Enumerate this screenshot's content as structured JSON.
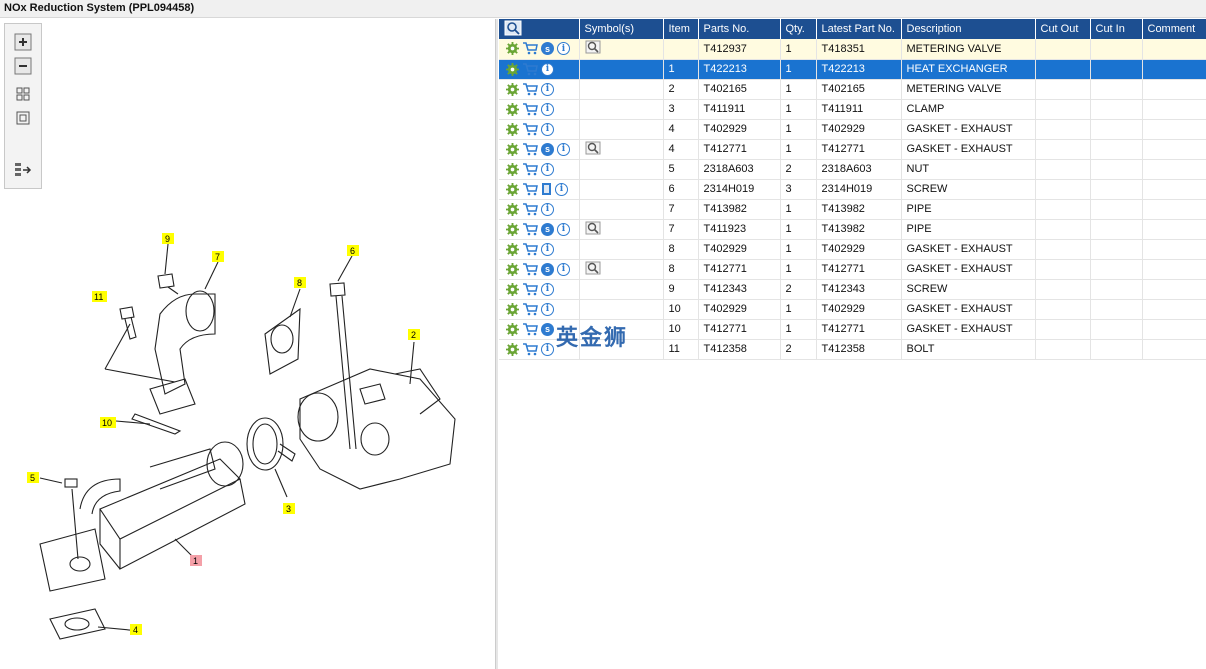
{
  "window": {
    "title": "NOx Reduction System (PPL094458)"
  },
  "toolbar": {
    "buttons": [
      "zoom-in-icon",
      "zoom-out-icon",
      "fit-all-icon",
      "fit-window-icon",
      "export-icon"
    ]
  },
  "diagram": {
    "callouts": [
      "9",
      "7",
      "6",
      "11",
      "8",
      "2",
      "10",
      "5",
      "3",
      "1",
      "4"
    ]
  },
  "table": {
    "headers": {
      "symbols": "Symbol(s)",
      "item": "Item",
      "parts_no": "Parts No.",
      "qty": "Qty.",
      "latest": "Latest Part No.",
      "description": "Description",
      "cut_out": "Cut Out",
      "cut_in": "Cut In",
      "comment": "Comment"
    },
    "rows": [
      {
        "item": "",
        "parts_no": "T412937",
        "qty": "1",
        "latest": "T418351",
        "description": "METERING VALVE",
        "icons": [
          "gear",
          "cart",
          "s",
          "i"
        ],
        "symbol": true
      },
      {
        "item": "1",
        "parts_no": "T422213",
        "qty": "1",
        "latest": "T422213",
        "description": "HEAT EXCHANGER",
        "icons": [
          "gear",
          "cart",
          "i"
        ],
        "symbol": false
      },
      {
        "item": "2",
        "parts_no": "T402165",
        "qty": "1",
        "latest": "T402165",
        "description": "METERING VALVE",
        "icons": [
          "gear",
          "cart",
          "i"
        ],
        "symbol": false
      },
      {
        "item": "3",
        "parts_no": "T411911",
        "qty": "1",
        "latest": "T411911",
        "description": "CLAMP",
        "icons": [
          "gear",
          "cart",
          "i"
        ],
        "symbol": false
      },
      {
        "item": "4",
        "parts_no": "T402929",
        "qty": "1",
        "latest": "T402929",
        "description": "GASKET - EXHAUST",
        "icons": [
          "gear",
          "cart",
          "i"
        ],
        "symbol": false
      },
      {
        "item": "4",
        "parts_no": "T412771",
        "qty": "1",
        "latest": "T412771",
        "description": "GASKET - EXHAUST",
        "icons": [
          "gear",
          "cart",
          "s",
          "i"
        ],
        "symbol": true
      },
      {
        "item": "5",
        "parts_no": "2318A603",
        "qty": "2",
        "latest": "2318A603",
        "description": "NUT",
        "icons": [
          "gear",
          "cart",
          "i"
        ],
        "symbol": false
      },
      {
        "item": "6",
        "parts_no": "2314H019",
        "qty": "3",
        "latest": "2314H019",
        "description": "SCREW",
        "icons": [
          "gear",
          "cart",
          "doc",
          "i"
        ],
        "symbol": false
      },
      {
        "item": "7",
        "parts_no": "T413982",
        "qty": "1",
        "latest": "T413982",
        "description": "PIPE",
        "icons": [
          "gear",
          "cart",
          "i"
        ],
        "symbol": false
      },
      {
        "item": "7",
        "parts_no": "T411923",
        "qty": "1",
        "latest": "T413982",
        "description": "PIPE",
        "icons": [
          "gear",
          "cart",
          "s",
          "i"
        ],
        "symbol": true
      },
      {
        "item": "8",
        "parts_no": "T402929",
        "qty": "1",
        "latest": "T402929",
        "description": "GASKET - EXHAUST",
        "icons": [
          "gear",
          "cart",
          "i"
        ],
        "symbol": false
      },
      {
        "item": "8",
        "parts_no": "T412771",
        "qty": "1",
        "latest": "T412771",
        "description": "GASKET - EXHAUST",
        "icons": [
          "gear",
          "cart",
          "s",
          "i"
        ],
        "symbol": true
      },
      {
        "item": "9",
        "parts_no": "T412343",
        "qty": "2",
        "latest": "T412343",
        "description": "SCREW",
        "icons": [
          "gear",
          "cart",
          "i"
        ],
        "symbol": false
      },
      {
        "item": "10",
        "parts_no": "T402929",
        "qty": "1",
        "latest": "T402929",
        "description": "GASKET - EXHAUST",
        "icons": [
          "gear",
          "cart",
          "i"
        ],
        "symbol": false
      },
      {
        "item": "10",
        "parts_no": "T412771",
        "qty": "1",
        "latest": "T412771",
        "description": "GASKET - EXHAUST",
        "icons": [
          "gear",
          "cart",
          "s"
        ],
        "symbol": false
      },
      {
        "item": "11",
        "parts_no": "T412358",
        "qty": "2",
        "latest": "T412358",
        "description": "BOLT",
        "icons": [
          "gear",
          "cart",
          "i"
        ],
        "symbol": false
      }
    ],
    "selected_index": 1
  },
  "watermark": "英金狮",
  "colors": {
    "header": "#1d4f91",
    "selected": "#1a73d0",
    "first_row": "#fffbe0",
    "callout": "#ffff00",
    "callout_active": "#f4a0a8"
  }
}
